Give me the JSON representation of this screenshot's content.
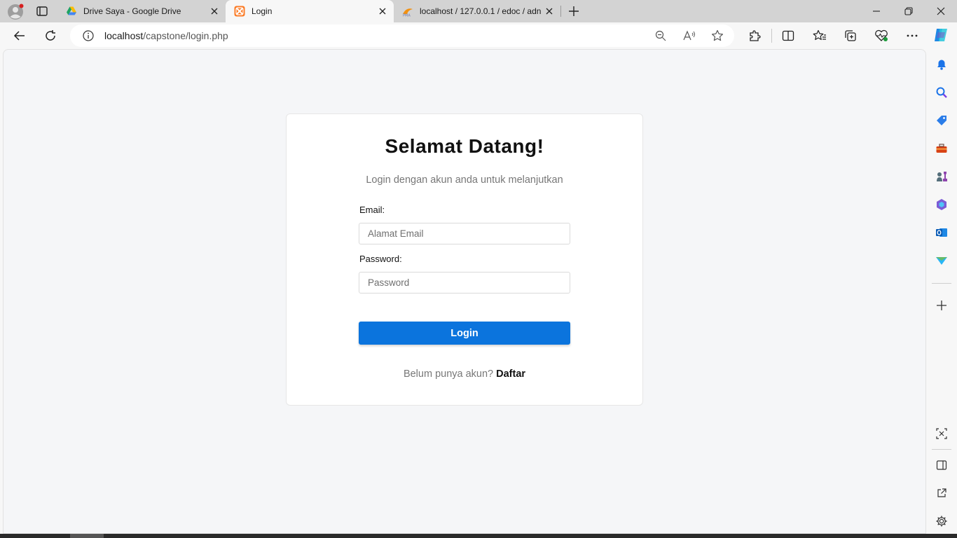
{
  "browser": {
    "tabs": [
      {
        "title": "Drive Saya - Google Drive",
        "active": false,
        "favicon": "google-drive-icon"
      },
      {
        "title": "Login",
        "active": true,
        "favicon": "xampp-icon"
      },
      {
        "title": "localhost / 127.0.0.1 / edoc / adn",
        "active": false,
        "favicon": "phpmyadmin-icon"
      }
    ],
    "address": {
      "host": "localhost",
      "path": "/capstone/login.php"
    }
  },
  "page": {
    "title": "Selamat Datang!",
    "subtitle": "Login dengan akun anda untuk melanjutkan",
    "email": {
      "label": "Email:",
      "placeholder": "Alamat Email"
    },
    "password": {
      "label": "Password:",
      "placeholder": "Password"
    },
    "login_label": "Login",
    "register_prompt": "Belum punya akun?",
    "register_link": "Daftar"
  },
  "colors": {
    "accent": "#0b74dd",
    "background": "#f5f6f8"
  }
}
